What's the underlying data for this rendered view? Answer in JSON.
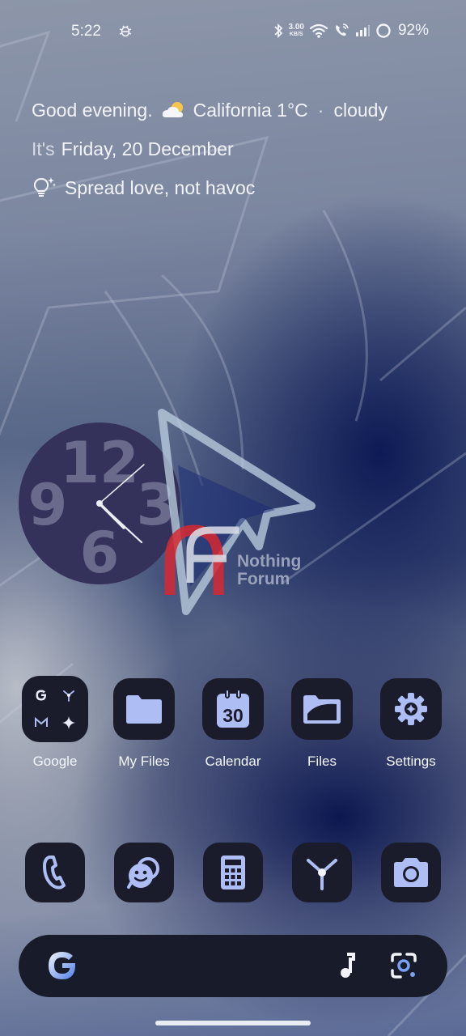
{
  "status_bar": {
    "time": "5:22",
    "net_speed_value": "3.00",
    "net_speed_unit": "KB/S",
    "battery": "92%"
  },
  "glance": {
    "greeting": "Good evening.",
    "location_temp": "California 1°C",
    "condition": "cloudy",
    "date_prefix": "It's",
    "date": "Friday, 20 December",
    "tip": "Spread love, not havoc"
  },
  "clock": {
    "numerals": [
      "12",
      "3",
      "6",
      "9"
    ]
  },
  "watermark": {
    "line1": "Nothing",
    "line2": "Forum"
  },
  "apps": [
    {
      "label": "Google",
      "icon": "google-folder-icon"
    },
    {
      "label": "My Files",
      "icon": "folder-icon"
    },
    {
      "label": "Calendar",
      "icon": "calendar-icon",
      "calendar_day": "30"
    },
    {
      "label": "Files",
      "icon": "files-icon"
    },
    {
      "label": "Settings",
      "icon": "gear-icon"
    }
  ],
  "dock": [
    {
      "icon": "phone-icon"
    },
    {
      "icon": "messages-icon"
    },
    {
      "icon": "calculator-icon"
    },
    {
      "icon": "fan-app-icon"
    },
    {
      "icon": "camera-icon"
    }
  ],
  "colors": {
    "icon_bg": "#1a1c2c",
    "icon_fg": "#aebef5",
    "clock_face": "#34325a",
    "clock_numerals": "#6a6b8c"
  }
}
